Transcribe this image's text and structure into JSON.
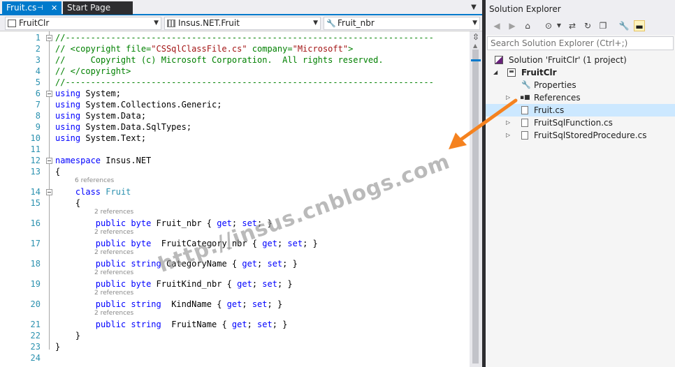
{
  "tabs": [
    {
      "label": "Fruit.cs",
      "active": true
    },
    {
      "label": "Start Page",
      "active": false
    }
  ],
  "navbar": {
    "project": "FruitClr",
    "type": "Insus.NET.Fruit",
    "member": "Fruit_nbr"
  },
  "code": {
    "lines": [
      {
        "n": "1",
        "text": "//-------------------------------------------------------------------------"
      },
      {
        "n": "2",
        "text": "// <copyright file=\"CSSqlClassFile.cs\" company=\"Microsoft\">"
      },
      {
        "n": "3",
        "text": "//     Copyright (c) Microsoft Corporation.  All rights reserved."
      },
      {
        "n": "4",
        "text": "// </copyright>"
      },
      {
        "n": "5",
        "text": "//-------------------------------------------------------------------------"
      },
      {
        "n": "6",
        "text": "using System;"
      },
      {
        "n": "7",
        "text": "using System.Collections.Generic;"
      },
      {
        "n": "8",
        "text": "using System.Data;"
      },
      {
        "n": "9",
        "text": "using System.Data.SqlTypes;"
      },
      {
        "n": "10",
        "text": "using System.Text;"
      },
      {
        "n": "11",
        "text": ""
      },
      {
        "n": "12",
        "text": "namespace Insus.NET"
      },
      {
        "n": "13",
        "text": "{"
      },
      {
        "n": "14",
        "text": "    class Fruit"
      },
      {
        "n": "15",
        "text": "    {"
      },
      {
        "n": "16",
        "text": "        public byte Fruit_nbr { get; set; }"
      },
      {
        "n": "17",
        "text": "        public byte  FruitCategory_nbr { get; set; }"
      },
      {
        "n": "18",
        "text": "        public string CategoryName { get; set; }"
      },
      {
        "n": "19",
        "text": "        public byte FruitKind_nbr { get; set; }"
      },
      {
        "n": "20",
        "text": "        public string  KindName { get; set; }"
      },
      {
        "n": "21",
        "text": "        public string  FruitName { get; set; }"
      },
      {
        "n": "22",
        "text": "    }"
      },
      {
        "n": "23",
        "text": "}"
      },
      {
        "n": "24",
        "text": ""
      }
    ],
    "class_lens": "6 references",
    "member_lens": "2 references"
  },
  "watermark": "http://insus.cnblogs.com",
  "solution_explorer": {
    "title": "Solution Explorer",
    "search_placeholder": "Search Solution Explorer (Ctrl+;)",
    "tree": [
      {
        "label": "Solution 'FruitClr' (1 project)",
        "icon": "solution-icon"
      },
      {
        "label": "FruitClr",
        "icon": "project-icon"
      },
      {
        "label": "Properties",
        "icon": "wrench-icon"
      },
      {
        "label": "References",
        "icon": "references-icon"
      },
      {
        "label": "Fruit.cs",
        "icon": "cs-file-icon",
        "selected": true
      },
      {
        "label": "FruitSqlFunction.cs",
        "icon": "cs-file-icon"
      },
      {
        "label": "FruitSqlStoredProcedure.cs",
        "icon": "cs-file-icon"
      }
    ]
  },
  "colors": {
    "accent": "#007acc",
    "comment": "#008000",
    "keyword": "#0000ff",
    "type": "#2b91af",
    "string": "#a31515",
    "arrow": "#f5821f"
  }
}
